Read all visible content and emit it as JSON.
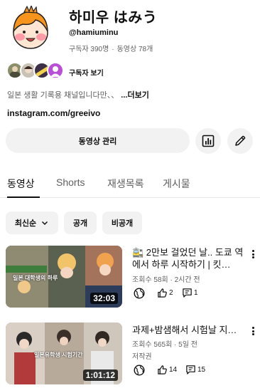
{
  "channel": {
    "name": "하미우 はみう",
    "handle": "@hamiuminu",
    "subscribers": "구독자 390명",
    "separator": "·",
    "video_count": "동영상 78개",
    "subscribers_link": "구독자 보기",
    "description": "일본 생활 기록용 채널입니다만、、",
    "description_more": "...더보기",
    "link": "instagram.com/greeivo",
    "manage_videos_label": "동영상 관리",
    "stats_icon": "bar-chart-icon",
    "edit_icon": "pencil-icon"
  },
  "tabs": [
    {
      "label": "동영상",
      "active": true
    },
    {
      "label": "Shorts",
      "active": false
    },
    {
      "label": "재생목록",
      "active": false
    },
    {
      "label": "게시물",
      "active": false
    }
  ],
  "filters": {
    "sort_label": "최신순",
    "public_label": "공개",
    "private_label": "비공개"
  },
  "videos": [
    {
      "title": "🚉 2만보 걸었던 날.. 도쿄 역에서 하루 시작하기 | 킷…",
      "meta": "조회수 58회 · 2시간 전",
      "extra": "",
      "duration": "32:03",
      "thumb_caption": "일본 대학생의 하루",
      "likes": "2",
      "comments": "1"
    },
    {
      "title": "과제+밤샘해서 시험날 지…",
      "meta": "조회수 565회 · 5일 전",
      "extra": "저작권",
      "duration": "1:01:12",
      "thumb_caption": "일본유학생 시험기간",
      "likes": "14",
      "comments": "15"
    }
  ],
  "colors": {
    "text": "#0f0f0f",
    "secondary": "#606060",
    "chip_bg": "#f2f2f2"
  }
}
